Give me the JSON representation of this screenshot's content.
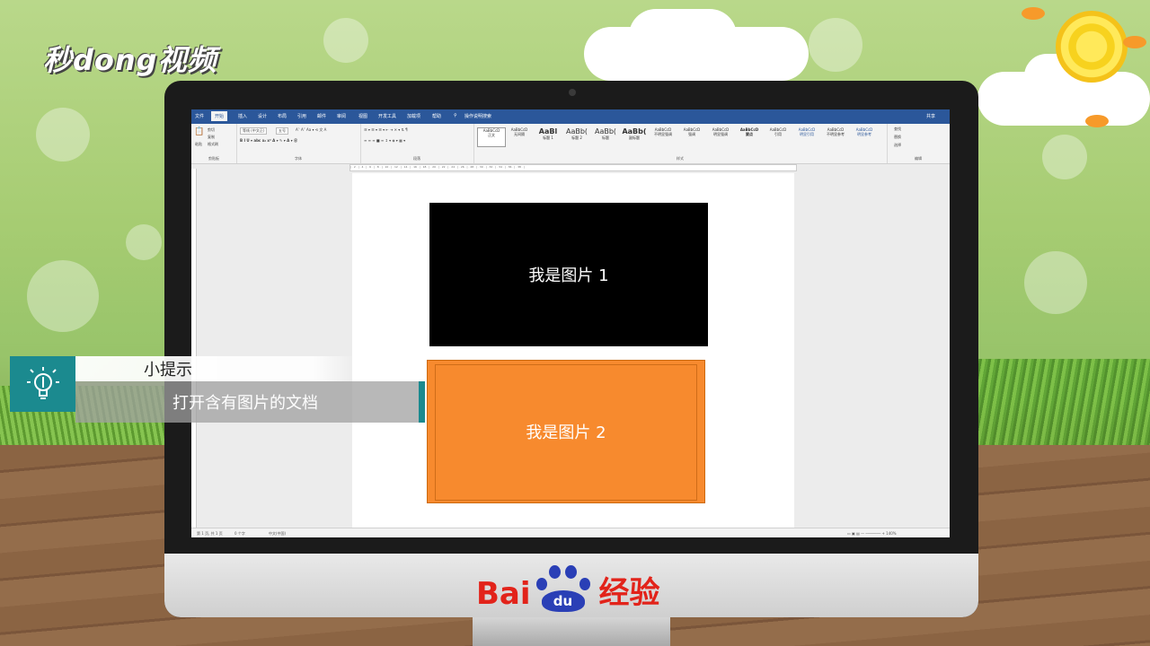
{
  "watermark": {
    "brand": "秒dong视频"
  },
  "word": {
    "tabs": [
      "文件",
      "开始",
      "插入",
      "设计",
      "布局",
      "引用",
      "邮件",
      "审阅",
      "视图",
      "开发工具",
      "加载项",
      "帮助",
      "操作说明搜索"
    ],
    "share": "共享",
    "clipboard": {
      "paste": "粘贴",
      "cut": "剪切",
      "copy": "复制",
      "format_painter": "格式刷",
      "label": "剪贴板"
    },
    "font": {
      "name": "等线 (中文正)",
      "size": "五号",
      "label": "字体"
    },
    "paragraph": {
      "label": "段落"
    },
    "styles": {
      "label": "样式",
      "items": [
        {
          "sample": "AaBbCcD",
          "name": "正文"
        },
        {
          "sample": "AaBbCcD",
          "name": "无间隔"
        },
        {
          "sample": "AaBl",
          "name": "标题 1"
        },
        {
          "sample": "AaBb(",
          "name": "标题 2"
        },
        {
          "sample": "AaBb(",
          "name": "标题"
        },
        {
          "sample": "AaBb(",
          "name": "副标题"
        },
        {
          "sample": "AaBbCcD",
          "name": "不明显强调"
        },
        {
          "sample": "AaBbCcD",
          "name": "强调"
        },
        {
          "sample": "AaBbCcD",
          "name": "明显强调"
        },
        {
          "sample": "AaBbCcD",
          "name": "要点"
        },
        {
          "sample": "AaBbCcD",
          "name": "引用"
        },
        {
          "sample": "AaBbCcD",
          "name": "明显引用"
        },
        {
          "sample": "AaBbCcD",
          "name": "不明显参考"
        },
        {
          "sample": "AaBbCcD",
          "name": "明显参考"
        }
      ]
    },
    "editing": {
      "find": "查找",
      "replace": "替换",
      "select": "选择",
      "label": "编辑"
    },
    "document": {
      "image1_text": "我是图片 1",
      "image2_text": "我是图片 2"
    },
    "status": {
      "page": "第 1 页, 共 1 页",
      "words": "0 个字",
      "lang": "中文(中国)"
    }
  },
  "tip": {
    "title": "小提示",
    "body": "打开含有图片的文档"
  },
  "baidu": {
    "left": "Bai",
    "paw": "du",
    "right": "经验"
  },
  "colors": {
    "word_blue": "#2b579a",
    "image2_orange": "#f78a2e",
    "tip_teal": "#1b8a8f",
    "baidu_red": "#e2231a",
    "baidu_blue": "#2a3fb6"
  }
}
